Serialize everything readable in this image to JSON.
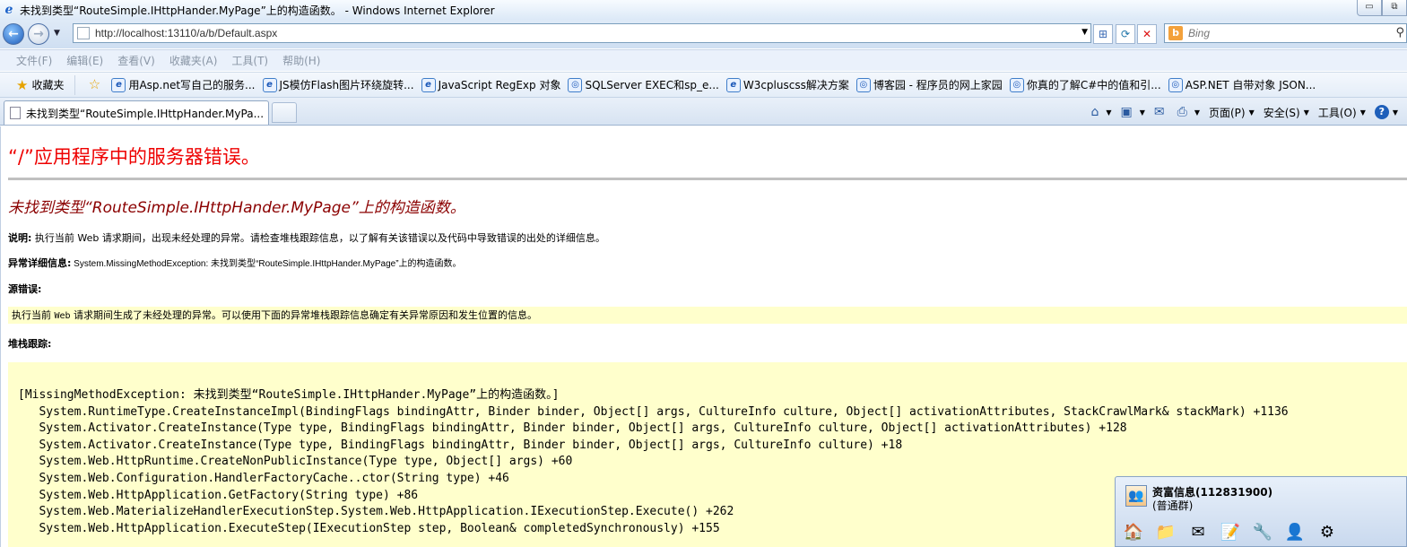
{
  "window": {
    "title": "未找到类型“RouteSimple.IHttpHander.MyPage”上的构造函数。 - Windows Internet Explorer",
    "minimize": "▭",
    "restore": "⧉"
  },
  "address": {
    "url": "http://localhost:13110/a/b/Default.aspx",
    "search_placeholder": "Bing"
  },
  "menu": [
    "文件(F)",
    "编辑(E)",
    "查看(V)",
    "收藏夹(A)",
    "工具(T)",
    "帮助(H)"
  ],
  "favorites": {
    "label": "收藏夹",
    "items": [
      "用Asp.net写自己的服务...",
      "JS模仿Flash图片环绕旋转...",
      "JavaScript RegExp 对象",
      "SQLServer EXEC和sp_e...",
      "W3cpluscss解决方案",
      "博客园 - 程序员的网上家园",
      "你真的了解C#中的值和引...",
      "ASP.NET 自带对象 JSON..."
    ]
  },
  "tab": {
    "label": "未找到类型“RouteSimple.IHttpHander.MyPa..."
  },
  "commands": {
    "page": "页面(P)",
    "safety": "安全(S)",
    "tools": "工具(O)"
  },
  "error": {
    "heading": "“/”应用程序中的服务器错误。",
    "title": "未找到类型“RouteSimple.IHttpHander.MyPage”上的构造函数。",
    "desc_label": "说明:",
    "desc_text": " 执行当前 Web 请求期间，出现未经处理的异常。请检查堆栈跟踪信息，以了解有关该错误以及代码中导致错误的出处的详细信息。",
    "exc_label": "异常详细信息:",
    "exc_text": " System.MissingMethodException: 未找到类型“RouteSimple.IHttpHander.MyPage”上的构造函数。",
    "source_label": "源错误:",
    "source_pre": "执行当前 ",
    "source_web": "Web",
    "source_post": " 请求期间生成了未经处理的异常。可以使用下面的异常堆栈跟踪信息确定有关异常原因和发生位置的信息。",
    "stack_label": "堆栈跟踪:",
    "stack": [
      "[MissingMethodException: 未找到类型“RouteSimple.IHttpHander.MyPage”上的构造函数。]",
      "   System.RuntimeType.CreateInstanceImpl(BindingFlags bindingAttr, Binder binder, Object[] args, CultureInfo culture, Object[] activationAttributes, StackCrawlMark& stackMark) +1136",
      "   System.Activator.CreateInstance(Type type, BindingFlags bindingAttr, Binder binder, Object[] args, CultureInfo culture, Object[] activationAttributes) +128",
      "   System.Activator.CreateInstance(Type type, BindingFlags bindingAttr, Binder binder, Object[] args, CultureInfo culture) +18",
      "   System.Web.HttpRuntime.CreateNonPublicInstance(Type type, Object[] args) +60",
      "   System.Web.Configuration.HandlerFactoryCache..ctor(String type) +46",
      "   System.Web.HttpApplication.GetFactory(String type) +86",
      "   System.Web.MaterializeHandlerExecutionStep.System.Web.HttpApplication.IExecutionStep.Execute() +262",
      "   System.Web.HttpApplication.ExecuteStep(IExecutionStep step, Boolean& completedSynchronously) +155"
    ]
  },
  "popup": {
    "name": "资富信息(112831900)",
    "status": "(普通群)"
  }
}
